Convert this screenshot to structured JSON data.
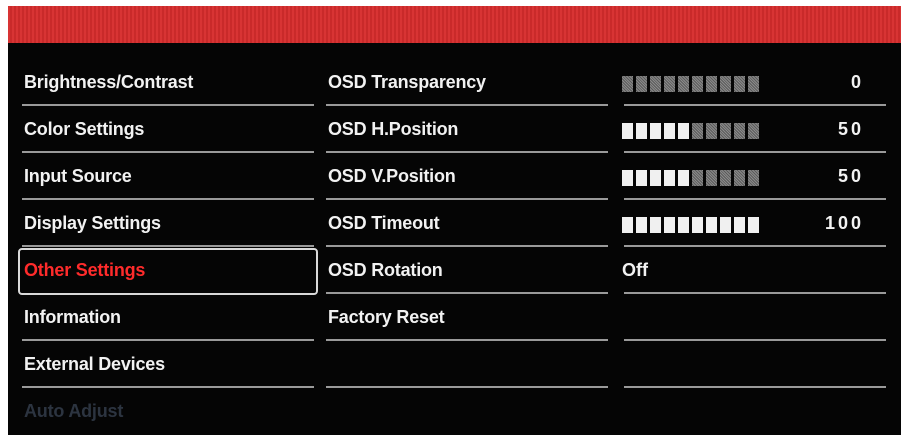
{
  "menu": {
    "items": [
      {
        "label": "Brightness/Contrast"
      },
      {
        "label": "Color Settings"
      },
      {
        "label": "Input Source"
      },
      {
        "label": "Display Settings"
      },
      {
        "label": "Other Settings",
        "selected": true
      },
      {
        "label": "Information"
      },
      {
        "label": "External Devices"
      },
      {
        "label": "Auto Adjust",
        "disabled": true
      }
    ]
  },
  "submenu": {
    "items": [
      {
        "label": "OSD Transparency"
      },
      {
        "label": "OSD H.Position"
      },
      {
        "label": "OSD V.Position"
      },
      {
        "label": "OSD Timeout"
      },
      {
        "label": "OSD Rotation"
      },
      {
        "label": "Factory Reset"
      },
      {
        "label": ""
      }
    ]
  },
  "values": [
    {
      "type": "bar",
      "level": 0,
      "value": "0"
    },
    {
      "type": "bar",
      "level": 0.5,
      "value": "50"
    },
    {
      "type": "bar",
      "level": 0.5,
      "value": "50"
    },
    {
      "type": "bar",
      "level": 1.0,
      "value": "100"
    },
    {
      "type": "text",
      "value": "Off"
    },
    {
      "type": "empty",
      "value": ""
    },
    {
      "type": "empty",
      "value": ""
    }
  ],
  "colors": {
    "header_red": "#d83434",
    "selected_text": "#ff2b2b",
    "text": "#f2f2f2",
    "disabled_text": "#2c3440"
  }
}
